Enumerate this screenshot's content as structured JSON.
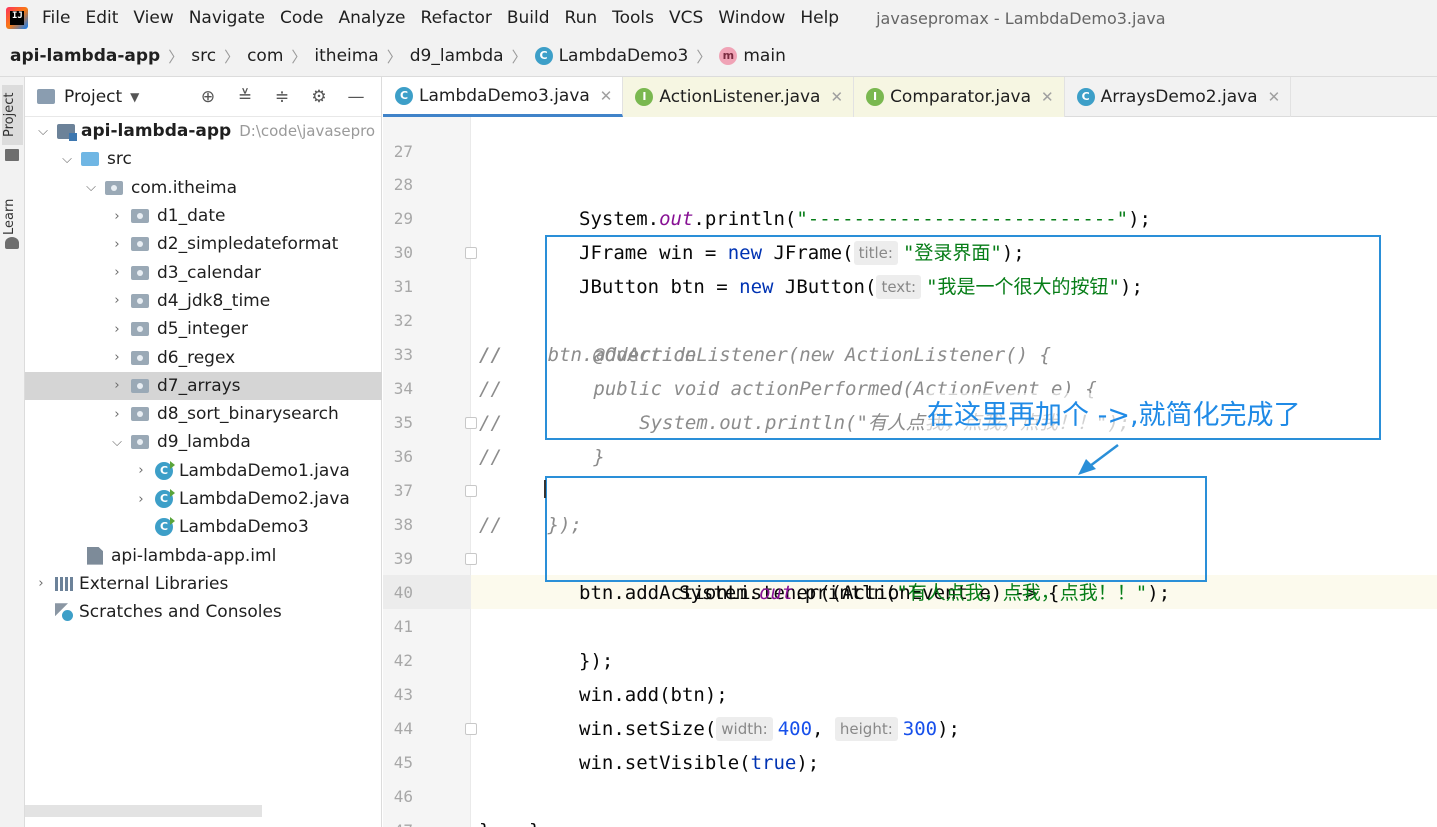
{
  "menubar": {
    "logo_text": "IJ",
    "items": [
      "File",
      "Edit",
      "View",
      "Navigate",
      "Code",
      "Analyze",
      "Refactor",
      "Build",
      "Run",
      "Tools",
      "VCS",
      "Window",
      "Help"
    ],
    "window_title": "javasepromax - LambdaDemo3.java"
  },
  "breadcrumb": {
    "items": [
      "api-lambda-app",
      "src",
      "com",
      "itheima",
      "d9_lambda",
      "LambdaDemo3",
      "main"
    ]
  },
  "tool_strip": {
    "project_label": "Project",
    "learn_label": "Learn"
  },
  "project_panel": {
    "title": "Project",
    "tree": [
      {
        "label": "api-lambda-app",
        "hint": "D:\\code\\javasepro",
        "bold": true
      },
      {
        "label": "src"
      },
      {
        "label": "com.itheima"
      },
      {
        "label": "d1_date"
      },
      {
        "label": "d2_simpledateformat"
      },
      {
        "label": "d3_calendar"
      },
      {
        "label": "d4_jdk8_time"
      },
      {
        "label": "d5_integer"
      },
      {
        "label": "d6_regex"
      },
      {
        "label": "d7_arrays",
        "selected": true
      },
      {
        "label": "d8_sort_binarysearch"
      },
      {
        "label": "d9_lambda"
      },
      {
        "label": "LambdaDemo1.java"
      },
      {
        "label": "LambdaDemo2.java"
      },
      {
        "label": "LambdaDemo3"
      },
      {
        "label": "api-lambda-app.iml"
      },
      {
        "label": "External Libraries"
      },
      {
        "label": "Scratches and Consoles"
      }
    ]
  },
  "tabs": [
    {
      "label": "LambdaDemo3.java",
      "icon": "C",
      "active": true
    },
    {
      "label": "ActionListener.java",
      "icon": "I"
    },
    {
      "label": "Comparator.java",
      "icon": "I"
    },
    {
      "label": "ArraysDemo2.java",
      "icon": "C"
    }
  ],
  "editor": {
    "line_numbers": [
      "27",
      "28",
      "29",
      "30",
      "31",
      "32",
      "33",
      "34",
      "35",
      "36",
      "37",
      "38",
      "39",
      "40",
      "41",
      "42",
      "43",
      "44",
      "45",
      "46",
      "47"
    ],
    "code": {
      "l28_a": "System.",
      "l28_b": "out",
      "l28_c": ".println(",
      "l28_d": "\"---------------------------\"",
      "l28_e": ");",
      "l29_a": "JFrame win = ",
      "l29_b": "new",
      "l29_c": " JFrame(",
      "l29_hint": "title:",
      "l29_d": "\"登录界面\"",
      "l29_e": ");",
      "l30_a": "JButton btn = ",
      "l30_b": "new",
      "l30_c": " JButton(",
      "l30_hint": "text:",
      "l30_d": "\"我是一个很大的按钮\"",
      "l30_e": ");",
      "l31": "//    btn.addActionListener(new ActionListener() {",
      "l32": "//        @Override",
      "l33": "//        public void actionPerformed(ActionEvent e) {",
      "l34": "//            System.out.println(\"有人点我，点我，点我！！\");",
      "l35": "//        }",
      "l36": "//    });",
      "l38": "btn.addActionListener((ActionEvent e) -> {",
      "l39_a": "System.",
      "l39_b": "out",
      "l39_c": ".println(",
      "l39_d": "\"有人点我，点我，点我！！\"",
      "l39_e": ");",
      "l40": "});",
      "l42": "win.add(btn);",
      "l43_a": "win.setSize(",
      "l43_hint_w": "width:",
      "l43_w": "400",
      "l43_sep": ", ",
      "l43_hint_h": "height:",
      "l43_h": "300",
      "l43_e": ");",
      "l44_a": "win.setVisible(",
      "l44_b": "true",
      "l44_c": ");",
      "l45": "}",
      "l46": "}"
    }
  },
  "annotation": {
    "text": "在这里再加个 ->,就简化完成了",
    "color": "#1f8ae6"
  }
}
